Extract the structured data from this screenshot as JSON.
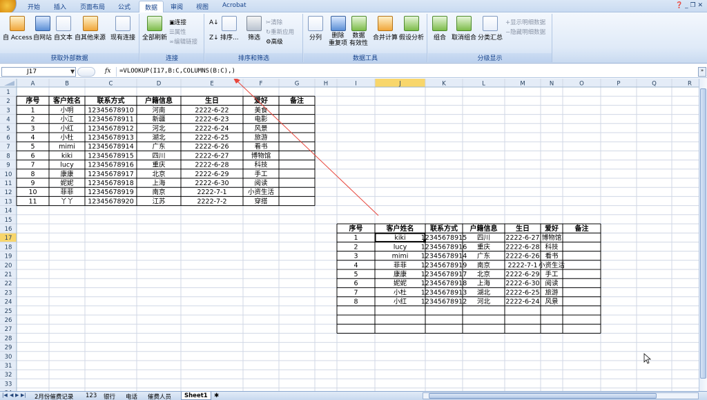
{
  "ribbon": {
    "tabs": [
      "开始",
      "插入",
      "页面布局",
      "公式",
      "数据",
      "审阅",
      "视图",
      "Acrobat"
    ],
    "active_tab": 4,
    "groups": {
      "external": {
        "title": "获取外部数据",
        "buttons": [
          "自 Access",
          "自网站",
          "自文本",
          "自其他来源",
          "现有连接"
        ]
      },
      "connections": {
        "title": "连接",
        "refresh": "全部刷新",
        "small": [
          "连接",
          "属性",
          "编辑链接"
        ]
      },
      "sortfilter": {
        "title": "排序和筛选",
        "sort": "排序...",
        "filter": "筛选",
        "small": [
          "清除",
          "重新应用",
          "高级"
        ]
      },
      "datatools": {
        "title": "数据工具",
        "buttons": [
          "分列",
          "删除\n重复项",
          "数据\n有效性",
          "合并计算",
          "假设分析"
        ]
      },
      "outline": {
        "title": "分级显示",
        "buttons": [
          "组合",
          "取消组合",
          "分类汇总"
        ],
        "small": [
          "显示明细数据",
          "隐藏明细数据"
        ]
      }
    }
  },
  "formula_bar": {
    "name_box": "J17",
    "fx": "fx",
    "formula": "=VLOOKUP(I17,B:C,COLUMNS(B:C),)"
  },
  "columns": [
    "A",
    "B",
    "C",
    "D",
    "E",
    "F",
    "G",
    "H",
    "I",
    "J",
    "K",
    "L",
    "M",
    "N",
    "O",
    "P",
    "Q",
    "R"
  ],
  "rows": [
    "1",
    "2",
    "3",
    "4",
    "5",
    "6",
    "7",
    "8",
    "9",
    "10",
    "11",
    "12",
    "13",
    "14",
    "15",
    "16",
    "17",
    "18",
    "19",
    "20",
    "21",
    "22",
    "23",
    "24",
    "25",
    "26",
    "27",
    "28",
    "29",
    "30",
    "31",
    "32",
    "33",
    "34"
  ],
  "selected_cell": {
    "col": "J",
    "row": "17"
  },
  "table1": {
    "headers": [
      "序号",
      "客户姓名",
      "联系方式",
      "户籍信息",
      "生日",
      "爱好",
      "备注"
    ],
    "rows": [
      [
        "1",
        "小明",
        "12345678910",
        "河南",
        "2222-6-22",
        "美食",
        ""
      ],
      [
        "2",
        "小江",
        "12345678911",
        "新疆",
        "2222-6-23",
        "电影",
        ""
      ],
      [
        "3",
        "小红",
        "12345678912",
        "河北",
        "2222-6-24",
        "风景",
        ""
      ],
      [
        "4",
        "小杜",
        "12345678913",
        "湖北",
        "2222-6-25",
        "旅游",
        ""
      ],
      [
        "5",
        "mimi",
        "12345678914",
        "广东",
        "2222-6-26",
        "看书",
        ""
      ],
      [
        "6",
        "kiki",
        "12345678915",
        "四川",
        "2222-6-27",
        "博物馆",
        ""
      ],
      [
        "7",
        "lucy",
        "12345678916",
        "重庆",
        "2222-6-28",
        "科技",
        ""
      ],
      [
        "8",
        "康康",
        "12345678917",
        "北京",
        "2222-6-29",
        "手工",
        ""
      ],
      [
        "9",
        "妮妮",
        "12345678918",
        "上海",
        "2222-6-30",
        "阅读",
        ""
      ],
      [
        "10",
        "菲菲",
        "12345678919",
        "南京",
        "2222-7-1",
        "小资生活",
        ""
      ],
      [
        "11",
        "丫丫",
        "12345678920",
        "江苏",
        "2222-7-2",
        "穿搭",
        ""
      ]
    ]
  },
  "table2": {
    "headers": [
      "序号",
      "客户姓名",
      "联系方式",
      "户籍信息",
      "生日",
      "爱好",
      "备注"
    ],
    "rows": [
      [
        "1",
        "kiki",
        "12345678915",
        "四川",
        "2222-6-27",
        "博物馆",
        ""
      ],
      [
        "2",
        "lucy",
        "12345678916",
        "重庆",
        "2222-6-28",
        "科技",
        ""
      ],
      [
        "3",
        "mimi",
        "12345678914",
        "广东",
        "2222-6-26",
        "看书",
        ""
      ],
      [
        "4",
        "菲菲",
        "12345678919",
        "南京",
        "2222-7-1",
        "小资生活",
        ""
      ],
      [
        "5",
        "康康",
        "12345678917",
        "北京",
        "2222-6-29",
        "手工",
        ""
      ],
      [
        "6",
        "妮妮",
        "12345678918",
        "上海",
        "2222-6-30",
        "阅读",
        ""
      ],
      [
        "7",
        "小杜",
        "12345678913",
        "湖北",
        "2222-6-25",
        "旅游",
        ""
      ],
      [
        "8",
        "小红",
        "12345678912",
        "河北",
        "2222-6-24",
        "风景",
        ""
      ],
      [
        "",
        "",
        "",
        "",
        "",
        "",
        ""
      ],
      [
        "",
        "",
        "",
        "",
        "",
        "",
        ""
      ],
      [
        "",
        "",
        "",
        "",
        "",
        "",
        ""
      ]
    ]
  },
  "sheet_tabs": [
    "2月份催费记录",
    "123",
    "银行",
    "电话",
    "催费人员",
    "Sheet1"
  ],
  "active_sheet": 5,
  "colors": {
    "accent": "#15428b",
    "arrow": "#e8463c",
    "selected_header": "#f8d66b",
    "header_bg": "#e4ecf7"
  }
}
